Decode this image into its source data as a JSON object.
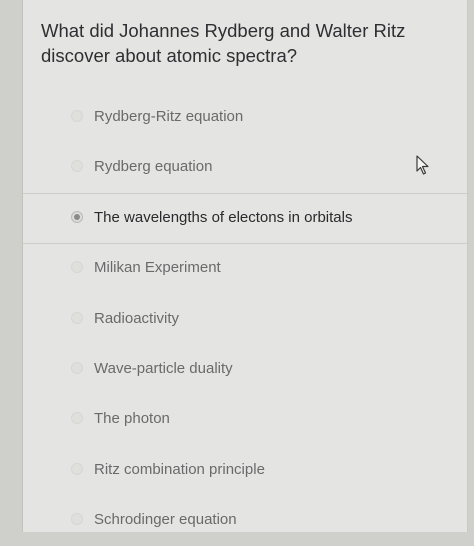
{
  "question": {
    "text": "What did Johannes Rydberg and Walter Ritz discover about atomic spectra?"
  },
  "options": [
    {
      "label": "Rydberg-Ritz equation",
      "selected": false
    },
    {
      "label": "Rydberg equation",
      "selected": false
    },
    {
      "label": "The wavelengths of electons in orbitals",
      "selected": true
    },
    {
      "label": "Milikan Experiment",
      "selected": false
    },
    {
      "label": "Radioactivity",
      "selected": false
    },
    {
      "label": "Wave-particle duality",
      "selected": false
    },
    {
      "label": "The photon",
      "selected": false
    },
    {
      "label": "Ritz combination principle",
      "selected": false
    },
    {
      "label": "Schrodinger equation",
      "selected": false
    }
  ],
  "cursor": {
    "icon": "mouse-pointer-icon"
  },
  "colors": {
    "background": "#e4e4e2",
    "text": "#2f2f33",
    "muted_text": "#6a6a6c"
  }
}
